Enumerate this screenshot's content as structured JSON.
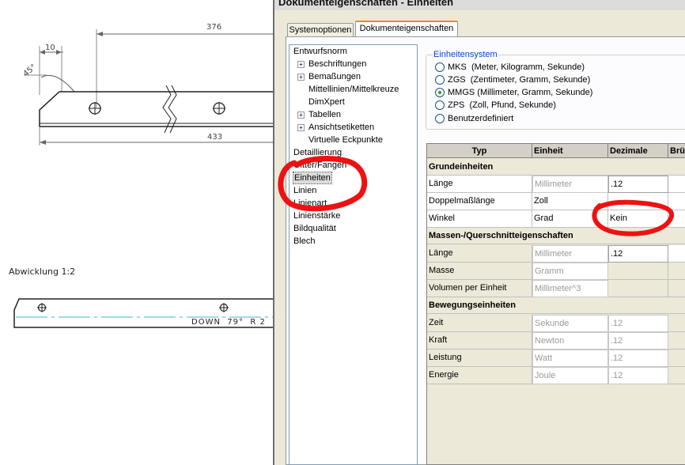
{
  "dialog": {
    "title": "Dokumenteigenschaften - Einheiten",
    "tabs": [
      {
        "label": "Systemoptionen",
        "active": false
      },
      {
        "label": "Dokumenteigenschaften",
        "active": true
      }
    ]
  },
  "tree": {
    "items": [
      {
        "label": "Entwurfsnorm",
        "expandable": false,
        "indent": 0
      },
      {
        "label": "Beschriftungen",
        "expandable": true,
        "indent": 1
      },
      {
        "label": "Bemaßungen",
        "expandable": true,
        "indent": 1
      },
      {
        "label": "Mittellinien/Mittelkreuze",
        "expandable": false,
        "indent": 1
      },
      {
        "label": "DimXpert",
        "expandable": false,
        "indent": 1
      },
      {
        "label": "Tabellen",
        "expandable": true,
        "indent": 1
      },
      {
        "label": "Ansichtsetiketten",
        "expandable": true,
        "indent": 1
      },
      {
        "label": "Virtuelle Eckpunkte",
        "expandable": false,
        "indent": 1
      },
      {
        "label": "Detaillierung",
        "expandable": false,
        "indent": 0
      },
      {
        "label": "Gitter/Fangen",
        "expandable": false,
        "indent": 0
      },
      {
        "label": "Einheiten",
        "expandable": false,
        "indent": 0,
        "selected": true
      },
      {
        "label": "Linien",
        "expandable": false,
        "indent": 0
      },
      {
        "label": "Linienart",
        "expandable": false,
        "indent": 0
      },
      {
        "label": "Linienstärke",
        "expandable": false,
        "indent": 0
      },
      {
        "label": "Bildqualität",
        "expandable": false,
        "indent": 0
      },
      {
        "label": "Blech",
        "expandable": false,
        "indent": 0
      }
    ]
  },
  "unit_system": {
    "label": "Einheitensystem",
    "options": [
      {
        "label": "MKS  (Meter, Kilogramm, Sekunde)",
        "checked": false
      },
      {
        "label": "ZGS  (Zentimeter, Gramm, Sekunde)",
        "checked": false
      },
      {
        "label": "MMGS (Millimeter, Gramm, Sekunde)",
        "checked": true
      },
      {
        "label": "ZPS  (Zoll, Pfund, Sekunde)",
        "checked": false
      },
      {
        "label": "Benutzerdefiniert",
        "checked": false
      }
    ]
  },
  "grid": {
    "headers": {
      "type": "Typ",
      "unit": "Einheit",
      "decimals": "Dezimale",
      "fractions": "Brü"
    },
    "sections": [
      {
        "title": "Grundeinheiten",
        "rows": [
          {
            "type": "Länge",
            "unit": "Millimeter",
            "unit_enabled": false,
            "decimals": ".12",
            "decimals_enabled": true
          },
          {
            "type": "Doppelmaßlänge",
            "unit": "Zoll",
            "unit_enabled": true,
            "decimals": "",
            "decimals_enabled": true
          },
          {
            "type": "Winkel",
            "unit": "Grad",
            "unit_enabled": true,
            "decimals": "Kein",
            "decimals_enabled": true
          }
        ]
      },
      {
        "title": "Massen-/Querschnitteigenschaften",
        "rows": [
          {
            "type": "Länge",
            "unit": "Millimeter",
            "unit_enabled": false,
            "decimals": ".12",
            "decimals_enabled": true
          },
          {
            "type": "Masse",
            "unit": "Gramm",
            "unit_enabled": false,
            "decimals": "",
            "decimals_enabled": false
          },
          {
            "type": "Volumen per Einheit",
            "unit": "Millimeter^3",
            "unit_enabled": false,
            "decimals": "",
            "decimals_enabled": false
          }
        ]
      },
      {
        "title": "Bewegungseinheiten",
        "rows": [
          {
            "type": "Zeit",
            "unit": "Sekunde",
            "unit_enabled": false,
            "decimals": ".12",
            "decimals_enabled": false
          },
          {
            "type": "Kraft",
            "unit": "Newton",
            "unit_enabled": false,
            "decimals": ".12",
            "decimals_enabled": false
          },
          {
            "type": "Leistung",
            "unit": "Watt",
            "unit_enabled": false,
            "decimals": ".12",
            "decimals_enabled": false
          },
          {
            "type": "Energie",
            "unit": "Joule",
            "unit_enabled": false,
            "decimals": ".12",
            "decimals_enabled": false
          }
        ]
      }
    ]
  },
  "drawing": {
    "dim_overall": "376",
    "dim_small": "10",
    "dim_angle": "45°",
    "dim_bottom": "433",
    "view_label": "Abwicklung 1:2",
    "bend_note": "DOWN  79°  R 2"
  },
  "colors": {
    "annotation": "#ee1111",
    "centerline": "#3cb7c8",
    "tab_accent": "#e68b2c"
  }
}
